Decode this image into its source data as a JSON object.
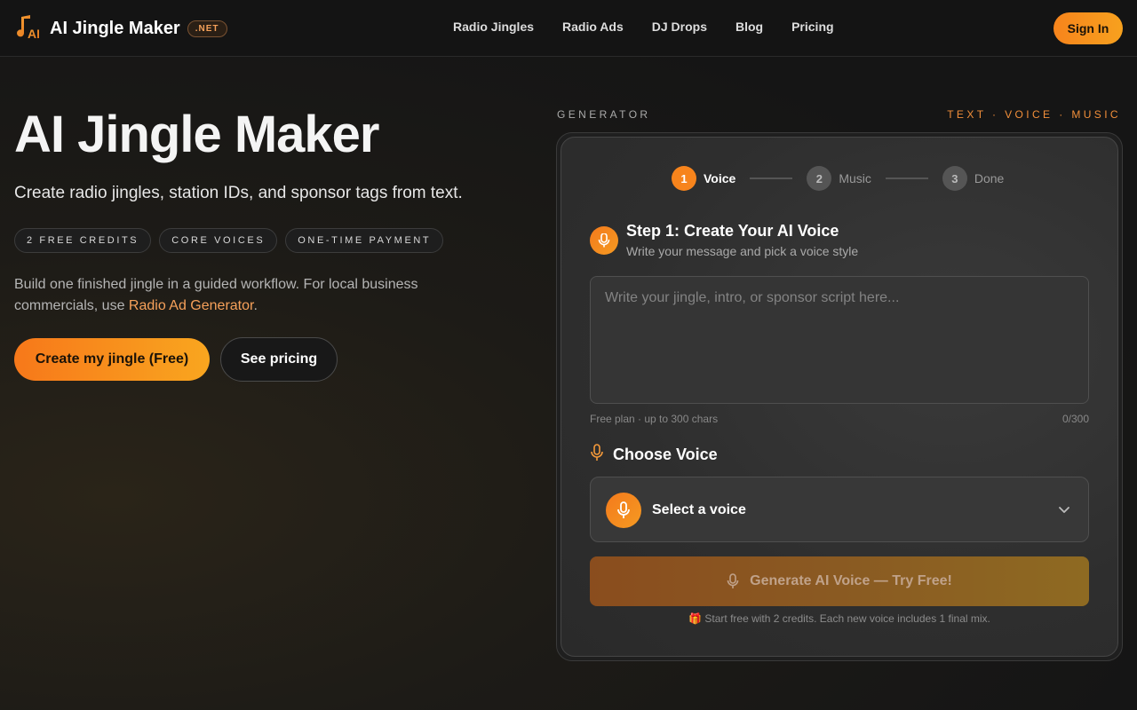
{
  "nav": {
    "brand": "AI Jingle Maker",
    "badge": ".NET",
    "links": [
      "Radio Jingles",
      "Radio Ads",
      "DJ Drops",
      "Blog",
      "Pricing"
    ],
    "signin": "Sign In"
  },
  "hero": {
    "title": "AI Jingle Maker",
    "subtitle": "Create radio jingles, station IDs, and sponsor tags from text.",
    "chips": [
      "2 FREE CREDITS",
      "CORE VOICES",
      "ONE-TIME PAYMENT"
    ],
    "desc_before": "Build one finished jingle in a guided workflow. For local business commercials, use ",
    "desc_link": "Radio Ad Generator",
    "desc_after": ".",
    "cta_primary": "Create my jingle (Free)",
    "cta_secondary": "See pricing"
  },
  "generator": {
    "label": "GENERATOR",
    "tags": "TEXT · VOICE · MUSIC",
    "steps": [
      {
        "num": "1",
        "label": "Voice"
      },
      {
        "num": "2",
        "label": "Music"
      },
      {
        "num": "3",
        "label": "Done"
      }
    ],
    "step_title": "Step 1: Create Your AI Voice",
    "step_subtitle": "Write your message and pick a voice style",
    "script_placeholder": "Write your jingle, intro, or sponsor script here...",
    "char_note": "Free plan · up to 300 chars",
    "char_count": "0/300",
    "choose_voice": "Choose Voice",
    "select_voice": "Select a voice",
    "generate_button": "Generate AI Voice — Try Free!",
    "footnote": "🎁 Start free with 2 credits. Each new voice includes 1 final mix."
  },
  "colors": {
    "accent": "#f7841c",
    "accent_light": "#f7a15a"
  }
}
